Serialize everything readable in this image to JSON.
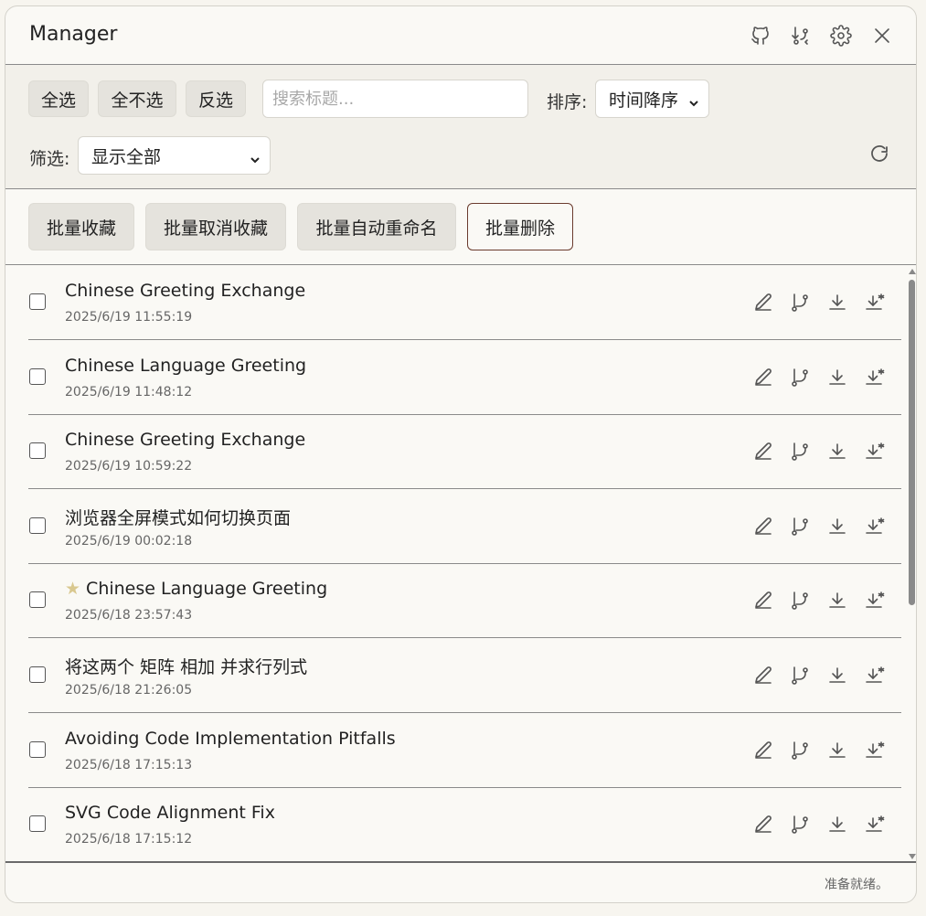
{
  "header": {
    "title": "Manager",
    "icons": [
      "github-icon",
      "branch-arrow-icon",
      "gear-icon",
      "close-icon"
    ]
  },
  "toolbar": {
    "select_all": "全选",
    "select_none": "全不选",
    "invert": "反选",
    "search_placeholder": "搜索标题...",
    "sort_label": "排序:",
    "sort_value": "时间降序",
    "filter_label": "筛选:",
    "filter_value": "显示全部"
  },
  "bulk": {
    "favorite": "批量收藏",
    "unfavorite": "批量取消收藏",
    "auto_rename": "批量自动重命名",
    "delete": "批量删除"
  },
  "items": [
    {
      "title": "Chinese Greeting Exchange",
      "date": "2025/6/19 11:55:19",
      "starred": false
    },
    {
      "title": "Chinese Language Greeting",
      "date": "2025/6/19 11:48:12",
      "starred": false
    },
    {
      "title": "Chinese Greeting Exchange",
      "date": "2025/6/19 10:59:22",
      "starred": false
    },
    {
      "title": "浏览器全屏模式如何切换页面",
      "date": "2025/6/19 00:02:18",
      "starred": false
    },
    {
      "title": "Chinese Language Greeting",
      "date": "2025/6/18 23:57:43",
      "starred": true
    },
    {
      "title": "将这两个 矩阵 相加 并求行列式",
      "date": "2025/6/18 21:26:05",
      "starred": false
    },
    {
      "title": "Avoiding Code Implementation Pitfalls",
      "date": "2025/6/18 17:15:13",
      "starred": false
    },
    {
      "title": "SVG Code Alignment Fix",
      "date": "2025/6/18 17:15:12",
      "starred": false
    }
  ],
  "status": "准备就绪。"
}
